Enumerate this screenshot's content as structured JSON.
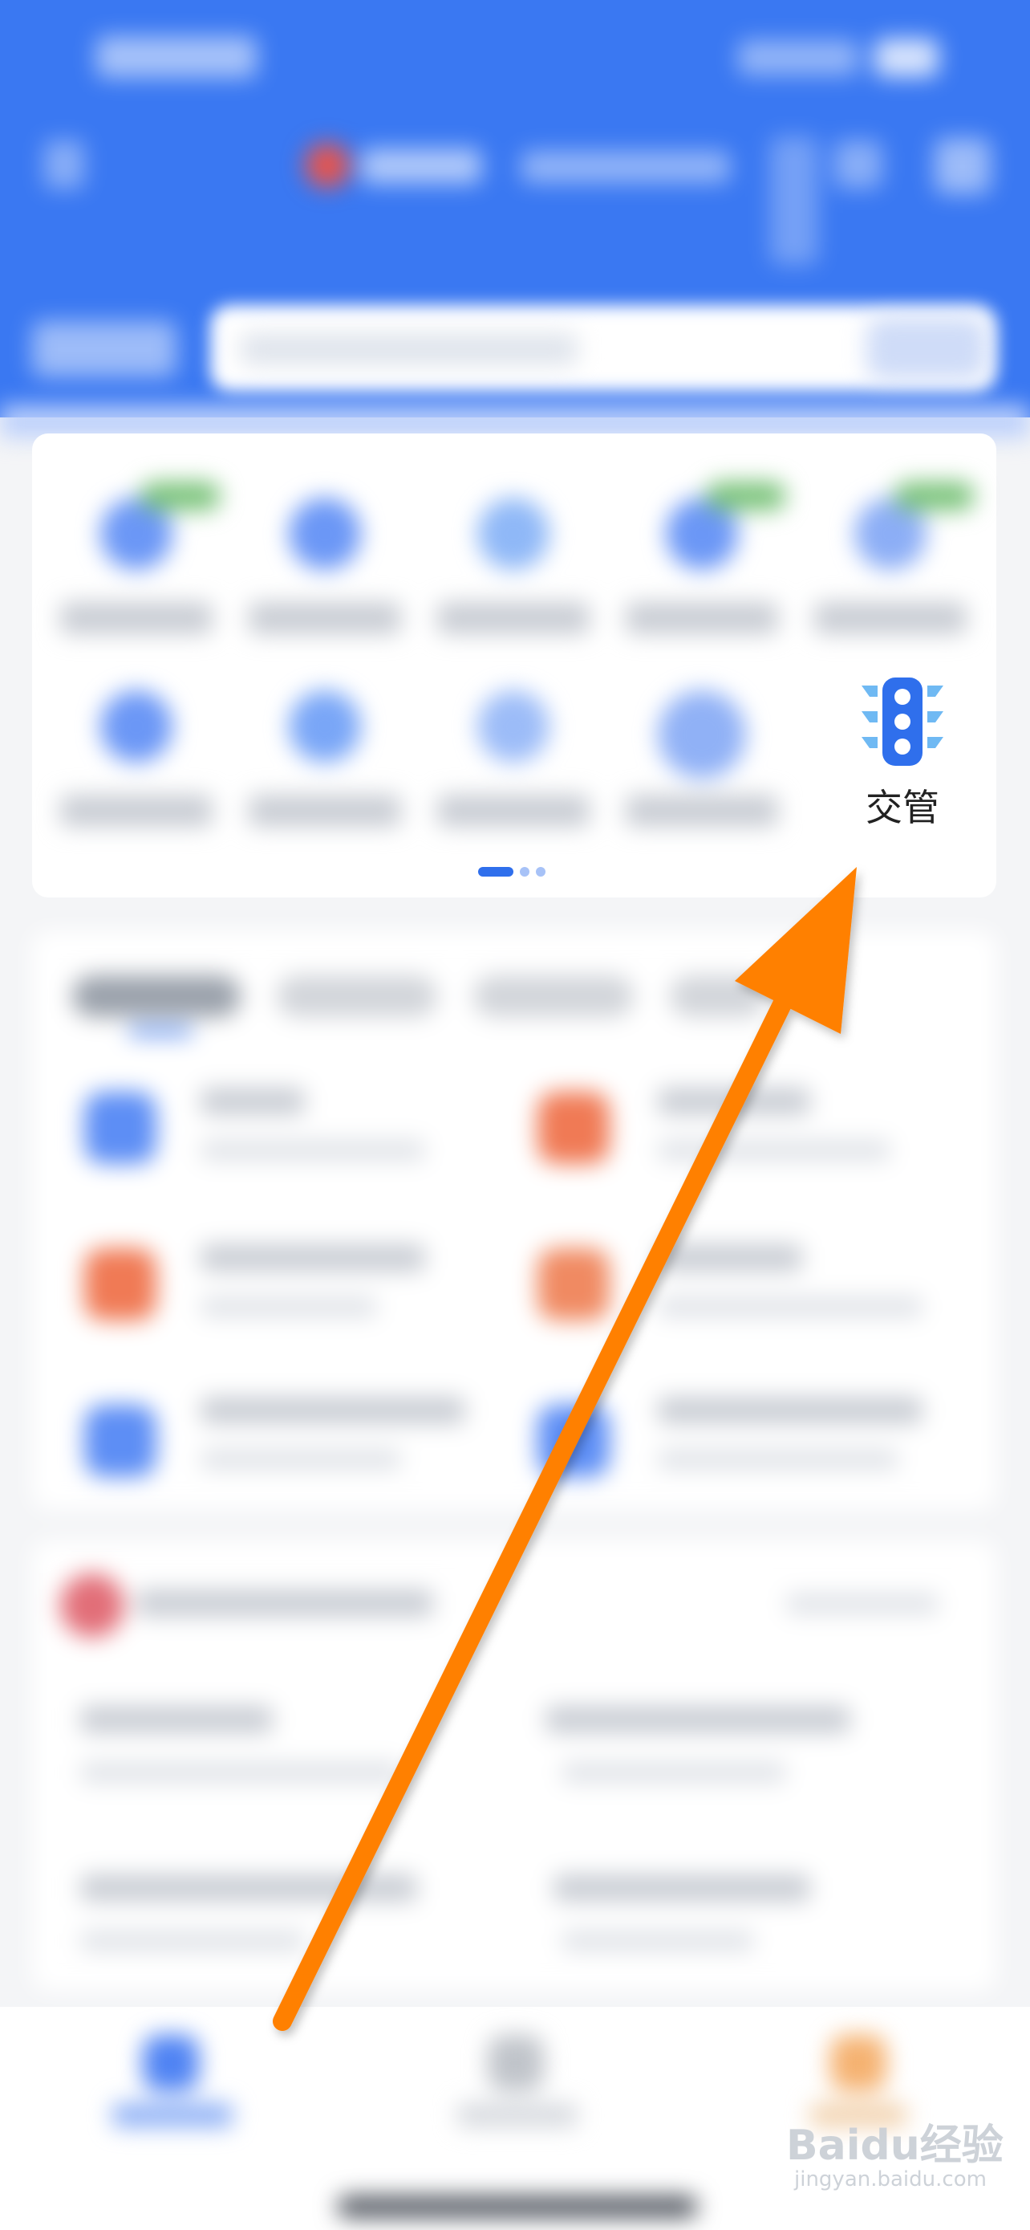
{
  "grid": {
    "traffic_item": {
      "label": "交管",
      "icon": "traffic-light-icon"
    },
    "pager_active_index": 0,
    "pager_count": 3
  },
  "watermark": {
    "main": "Baidu经验",
    "sub": "jingyan.baidu.com"
  },
  "colors": {
    "header_blue": "#3a78f2",
    "accent_blue": "#2f6fec",
    "arrow_orange": "#ff8000"
  }
}
